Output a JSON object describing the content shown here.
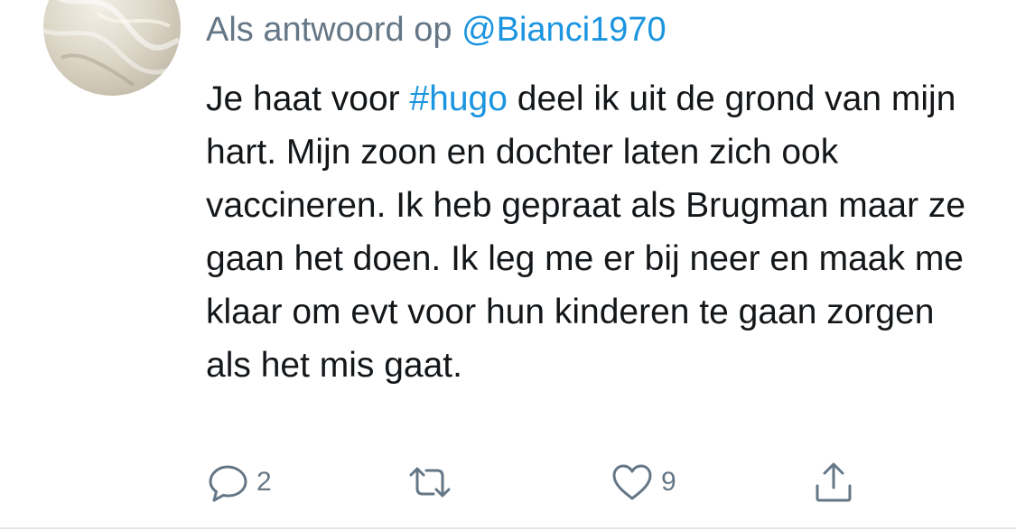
{
  "reply": {
    "prefix": "Als antwoord op",
    "mention": "@Bianci1970"
  },
  "tweet": {
    "text_before_hashtag": "Je haat voor",
    "hashtag": "#hugo",
    "text_after_hashtag": "deel ik uit de grond van mijn hart. Mijn zoon en dochter laten zich ook vaccineren. Ik heb gepraat als Brugman maar ze gaan het doen. Ik leg me er bij neer en maak me klaar om evt voor hun kinderen te gaan zorgen als het mis gaat."
  },
  "actions": {
    "reply_count": "2",
    "retweet_count": "",
    "like_count": "9"
  },
  "colors": {
    "link": "#1b95e0",
    "muted": "#657786",
    "text": "#14171a"
  },
  "icons": {
    "reply": "reply-icon",
    "retweet": "retweet-icon",
    "like": "heart-icon",
    "share": "share-icon"
  }
}
